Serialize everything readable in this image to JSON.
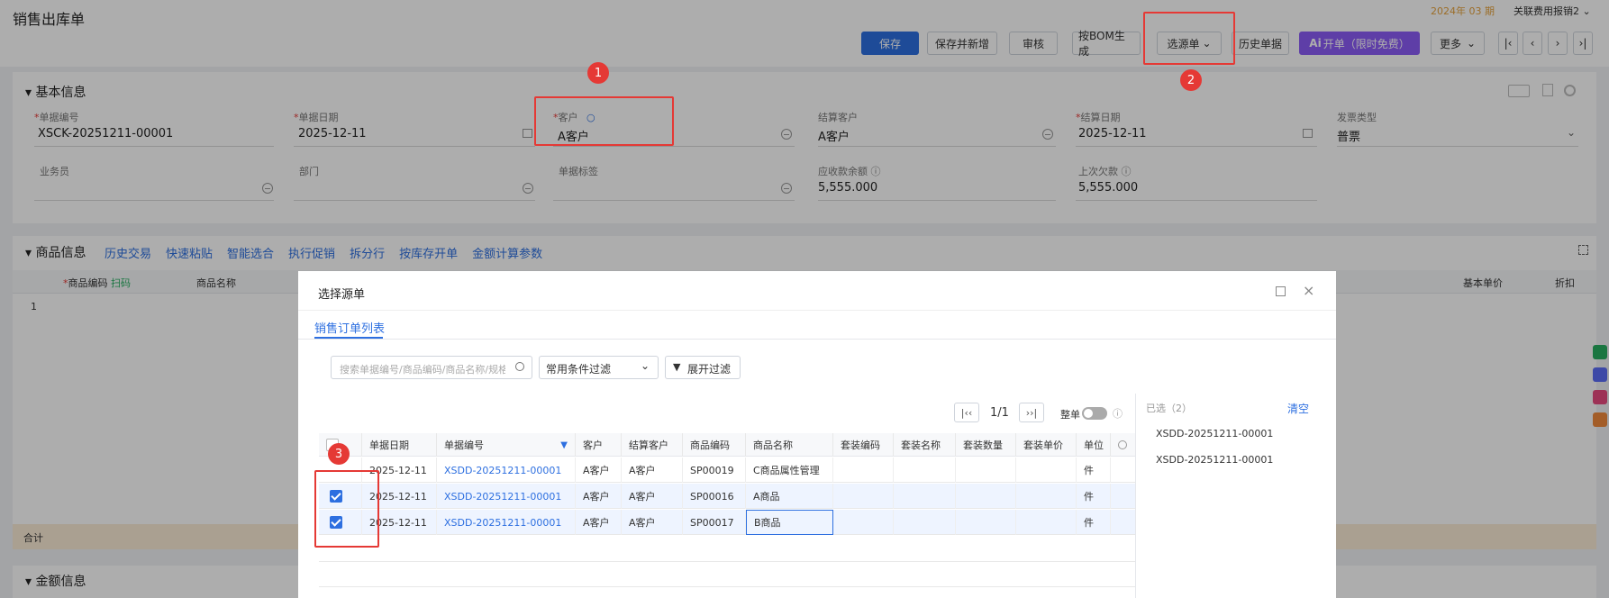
{
  "header": {
    "title": "销售出库单",
    "period": "2024年 03 期",
    "related": "关联费用报销2 ⌄",
    "buttons": {
      "save": "保存",
      "save_new": "保存并新增",
      "audit": "审核",
      "bom": "按BOM生成",
      "select_source": "选源单",
      "history": "历史单据",
      "ai_open": "开单（限时免费）",
      "more": "更多"
    },
    "nav": {
      "first": "|‹",
      "prev": "‹",
      "next": "›",
      "last": "›|"
    }
  },
  "basic_info": {
    "title": "基本信息",
    "fields": {
      "doc_no_label": "单据编号",
      "doc_no_value": "XSCK-20251211-00001",
      "doc_date_label": "单据日期",
      "doc_date_value": "2025-12-11",
      "customer_label": "客户",
      "customer_value": "A客户",
      "settle_customer_label": "结算客户",
      "settle_customer_value": "A客户",
      "settle_date_label": "结算日期",
      "settle_date_value": "2025-12-11",
      "invoice_type_label": "发票类型",
      "invoice_type_value": "普票",
      "salesman_label": "业务员",
      "dept_label": "部门",
      "doc_tag_label": "单据标签",
      "receivable_label": "应收款余额",
      "receivable_value": "5,555.000",
      "last_debt_label": "上次欠款",
      "last_debt_value": "5,555.000"
    }
  },
  "goods_info": {
    "title": "商品信息",
    "tools": [
      "历史交易",
      "快速粘贴",
      "智能选合",
      "执行促销",
      "拆分行",
      "按库存开单",
      "金额计算参数"
    ],
    "columns": {
      "code": "商品编码",
      "scan": "扫码",
      "name": "商品名称",
      "base_price": "基本单价",
      "discount": "折扣"
    },
    "row_no": "1",
    "total_label": "合计"
  },
  "amount_info": {
    "title": "金额信息"
  },
  "modal": {
    "title": "选择源单",
    "tab": "销售订单列表",
    "search_placeholder": "搜索单据编号/商品编码/商品名称/规格",
    "filter_select": "常用条件过滤",
    "expand_filter": "展开过滤",
    "page": "1/1",
    "whole_doc": "整单",
    "selected_label": "已选（2）",
    "clear": "清空",
    "selected": [
      "XSDD-20251211-00001",
      "XSDD-20251211-00001"
    ],
    "columns": [
      "单据日期",
      "单据编号",
      "客户",
      "结算客户",
      "商品编码",
      "商品名称",
      "套装编码",
      "套装名称",
      "套装数量",
      "套装单价",
      "单位"
    ],
    "rows": [
      {
        "date": "2025-12-11",
        "no": "XSDD-20251211-00001",
        "customer": "A客户",
        "settle": "A客户",
        "code": "SP00019",
        "name": "C商品属性管理",
        "unit": "件",
        "checked": false
      },
      {
        "date": "2025-12-11",
        "no": "XSDD-20251211-00001",
        "customer": "A客户",
        "settle": "A客户",
        "code": "SP00016",
        "name": "A商品",
        "unit": "件",
        "checked": true
      },
      {
        "date": "2025-12-11",
        "no": "XSDD-20251211-00001",
        "customer": "A客户",
        "settle": "A客户",
        "code": "SP00017",
        "name": "B商品",
        "unit": "件",
        "checked": true
      }
    ]
  },
  "annotations": {
    "b1": "1",
    "b2": "2",
    "b3": "3"
  }
}
